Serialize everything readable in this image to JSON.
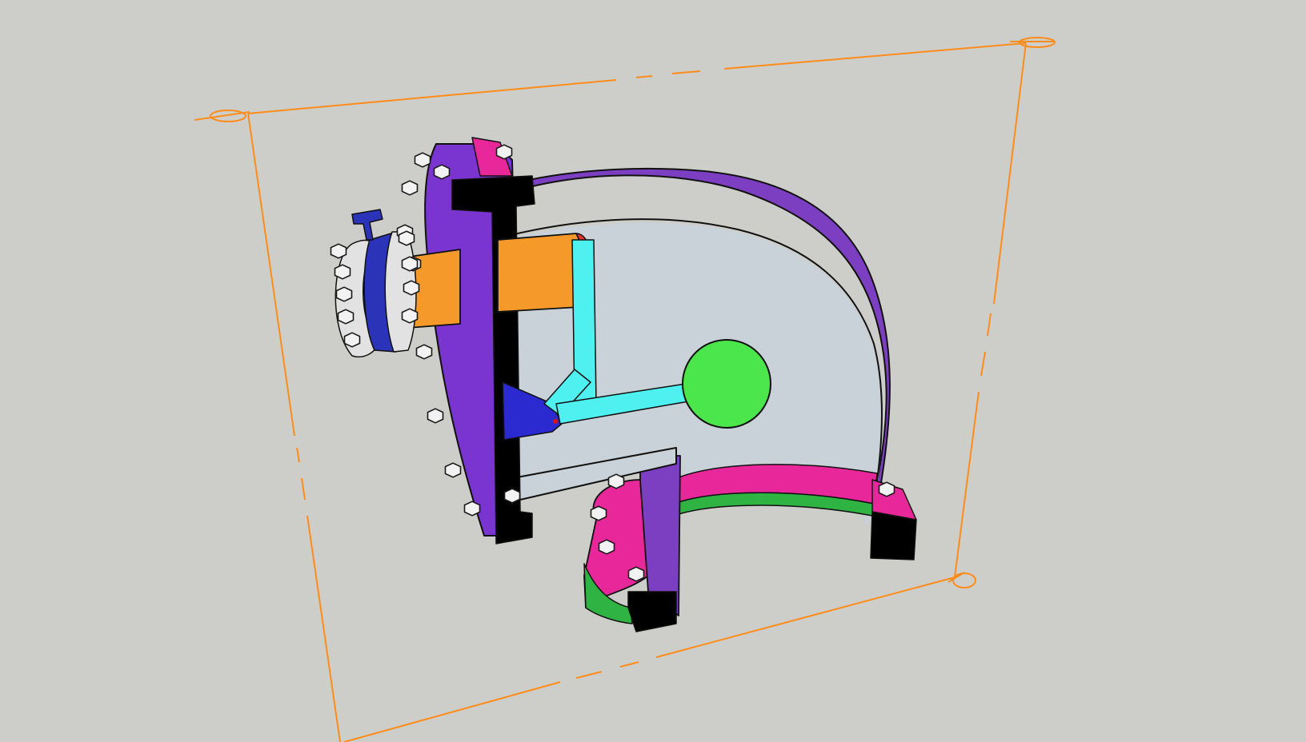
{
  "viewport": {
    "background": "#cdcdc9",
    "section_plane_color": "#ff8c1a"
  },
  "model": {
    "elbow_body_color": "#7d3fc1",
    "elbow_interior_color": "#c9d2d8",
    "flange_face_color": "#7a34d0",
    "flange_edge_color": "#e8279a",
    "gasket_color": "#2fb444",
    "section_cut_color": "#000000",
    "inlet_pipe_color": "#f59a2a",
    "pipe_seal_color": "#e8322a",
    "float_ball_color": "#4be64b",
    "lever_arm_color": "#4ff0f0",
    "pivot_bracket_color": "#2a2ad0",
    "valve_body_color": "#2b34b8",
    "valve_flange_color": "#e2e2e2",
    "bolt_color": "#f2f2f2"
  }
}
